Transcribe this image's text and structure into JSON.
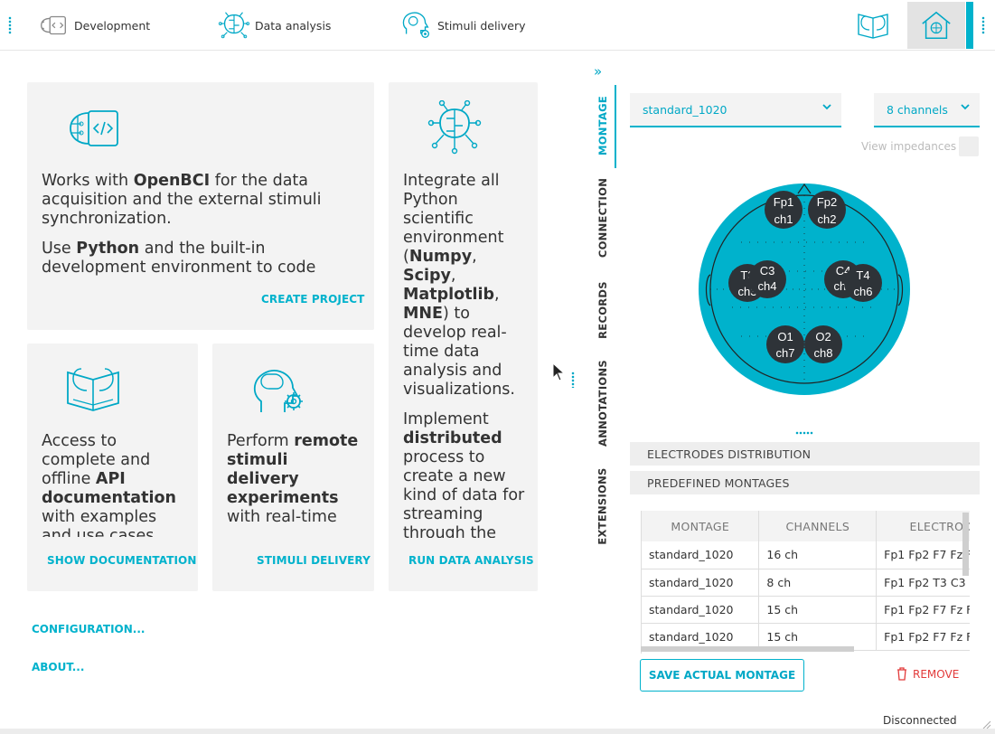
{
  "topbar": {
    "tabs": [
      {
        "label": "Development",
        "icon": "brain-code-icon"
      },
      {
        "label": "Data analysis",
        "icon": "brain-circuit-icon"
      },
      {
        "label": "Stimuli delivery",
        "icon": "head-gear-icon"
      }
    ],
    "right_icons": [
      "brain-book-icon",
      "home-brain-icon"
    ]
  },
  "cards": {
    "development": {
      "p1_a": "Works with ",
      "p1_b": "OpenBCI",
      "p1_c": " for the data acquisition and the external stimuli synchronization.",
      "p2_a": "Use ",
      "p2_b": "Python",
      "p2_c": " and the built-in development environment to code",
      "link": "CREATE PROJECT"
    },
    "analysis": {
      "p1_a": "Integrate all Python scientific environment (",
      "p1_b1": "Numpy",
      "p1_s1": ", ",
      "p1_b2": "Scipy",
      "p1_s2": ", ",
      "p1_b3": "Matplotlib",
      "p1_s3": ", ",
      "p1_b4": "MNE",
      "p1_c": ") to develop real-time data analysis and visualizations.",
      "p2_a": "Implement ",
      "p2_b": "distributed",
      "p2_c": " process to create a new kind of data for streaming through the",
      "link": "RUN DATA ANALYSIS"
    },
    "documentation": {
      "p1_a": "Access to complete and offline ",
      "p1_b": "API documentation",
      "p1_c": " with examples and use cases",
      "link": "SHOW DOCUMENTATION"
    },
    "stimuli": {
      "p1_a": "Perform ",
      "p1_b": "remote stimuli delivery experiments",
      "p1_c": " with real-time",
      "link": "STIMULI DELIVERY"
    }
  },
  "side_links": {
    "configuration": "CONFIGURATION...",
    "about": "ABOUT..."
  },
  "vtabs": [
    "MONTAGE",
    "CONNECTION",
    "RECORDS",
    "ANNOTATIONS",
    "EXTENSIONS"
  ],
  "montage": {
    "montage_select": "standard_1020",
    "channels_select": "8 channels",
    "view_impedances": "View impedances",
    "electrodes": [
      {
        "name": "Fp1",
        "ch": "ch1"
      },
      {
        "name": "Fp2",
        "ch": "ch2"
      },
      {
        "name": "T3",
        "ch": "ch3"
      },
      {
        "name": "C3",
        "ch": "ch4"
      },
      {
        "name": "C4",
        "ch": "ch5"
      },
      {
        "name": "T4",
        "ch": "ch6"
      },
      {
        "name": "O1",
        "ch": "ch7"
      },
      {
        "name": "O2",
        "ch": "ch8"
      }
    ],
    "accordion": [
      "ELECTRODES DISTRIBUTION",
      "PREDEFINED MONTAGES"
    ],
    "table": {
      "headers": [
        "MONTAGE",
        "CHANNELS",
        "ELECTRODES"
      ],
      "rows": [
        [
          "standard_1020",
          "16 ch",
          "Fp1 Fp2 F7 Fz F"
        ],
        [
          "standard_1020",
          "8 ch",
          "Fp1 Fp2 T3 C3"
        ],
        [
          "standard_1020",
          "15 ch",
          "Fp1 Fp2 F7 Fz F"
        ],
        [
          "standard_1020",
          "15 ch",
          "Fp1 Fp2 F7 Fz F"
        ]
      ]
    },
    "save_button": "SAVE ACTUAL MONTAGE",
    "remove_button": "REMOVE"
  },
  "status": "Disconnected",
  "colors": {
    "accent": "#00b2cc",
    "remove": "#e23a3a",
    "electrode": "#2e3338"
  }
}
